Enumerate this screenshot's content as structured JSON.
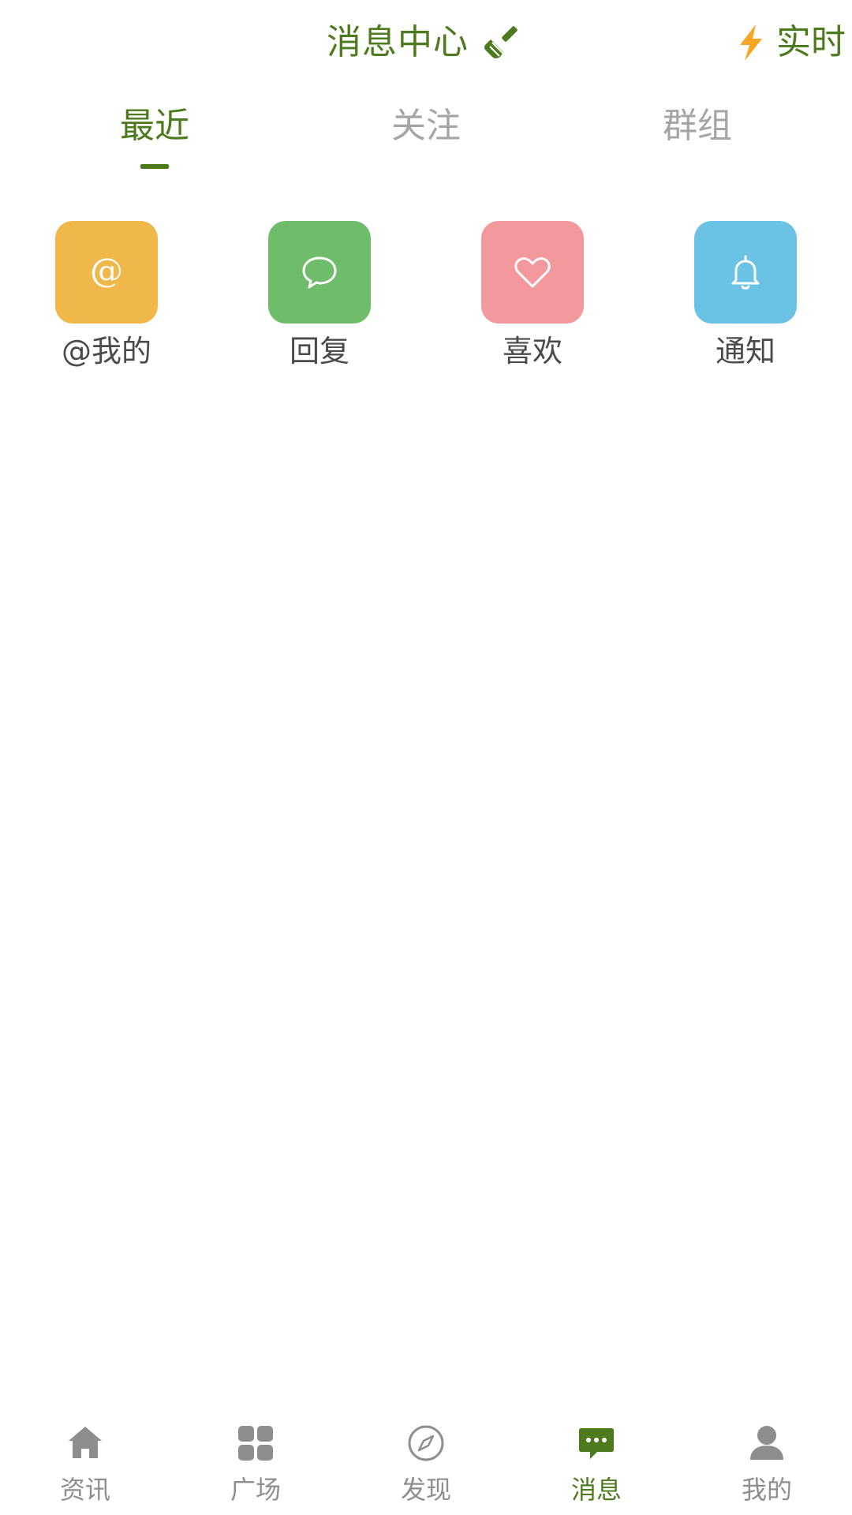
{
  "header": {
    "title": "消息中心",
    "clear_icon": "broom-icon",
    "realtime_label": "实时",
    "realtime_icon": "lightning-icon"
  },
  "tabs": [
    {
      "label": "最近",
      "active": true
    },
    {
      "label": "关注",
      "active": false
    },
    {
      "label": "群组",
      "active": false
    }
  ],
  "quick_items": [
    {
      "label": "@我的",
      "icon": "at-icon",
      "color": "#f0b84a"
    },
    {
      "label": "回复",
      "icon": "chat-bubble-icon",
      "color": "#6fbd6b"
    },
    {
      "label": "喜欢",
      "icon": "heart-icon",
      "color": "#f3999e"
    },
    {
      "label": "通知",
      "icon": "bell-icon",
      "color": "#6ac3e4"
    }
  ],
  "bottom_nav": [
    {
      "label": "资讯",
      "icon": "home-icon",
      "active": false
    },
    {
      "label": "广场",
      "icon": "grid-icon",
      "active": false
    },
    {
      "label": "发现",
      "icon": "compass-icon",
      "active": false
    },
    {
      "label": "消息",
      "icon": "message-icon",
      "active": true
    },
    {
      "label": "我的",
      "icon": "user-icon",
      "active": false
    }
  ],
  "colors": {
    "accent": "#4e7a1e",
    "inactive": "#a5a5a5",
    "bolt": "#f5a623"
  }
}
